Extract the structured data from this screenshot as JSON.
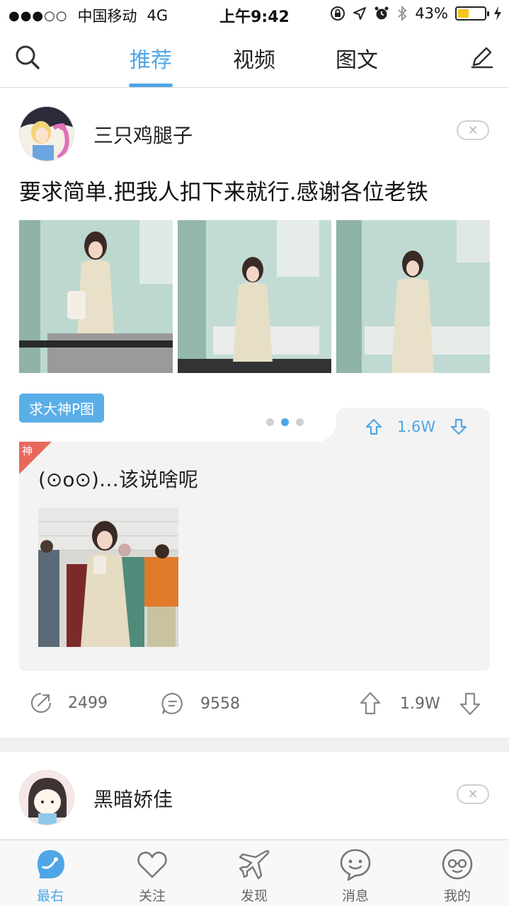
{
  "status_bar": {
    "signal_dots": "●●●○○",
    "carrier": "中国移动",
    "network": "4G",
    "time": "上午9:42",
    "battery_percent": "43%",
    "battery_level": 0.43
  },
  "top_nav": {
    "tabs": [
      {
        "label": "推荐",
        "active": true
      },
      {
        "label": "视频",
        "active": false
      },
      {
        "label": "图文",
        "active": false
      }
    ]
  },
  "post": {
    "username": "三只鸡腿子",
    "close_glyph": "✕",
    "title": "要求简单.把我人扣下来就行.感谢各位老铁",
    "tag": "求大神P图",
    "god_comment": {
      "badge": "神",
      "text": "(⊙o⊙)…该说啥呢",
      "votes": "1.6W"
    },
    "share_count": "2499",
    "comment_count": "9558",
    "votes": "1.9W"
  },
  "next_post": {
    "username": "黑暗娇佳",
    "close_glyph": "✕"
  },
  "bottom_bar": {
    "items": [
      {
        "label": "最右",
        "icon": "zuiyou-logo-icon",
        "active": true
      },
      {
        "label": "关注",
        "icon": "heart-icon",
        "active": false
      },
      {
        "label": "发现",
        "icon": "airplane-icon",
        "active": false
      },
      {
        "label": "消息",
        "icon": "chat-bubble-icon",
        "active": false
      },
      {
        "label": "我的",
        "icon": "profile-face-icon",
        "active": false
      }
    ]
  },
  "colors": {
    "accent": "#4ea6e6",
    "tag_bg": "#5aaee8",
    "badge_red": "#e8695c",
    "card_bg": "#f3f3f3"
  }
}
